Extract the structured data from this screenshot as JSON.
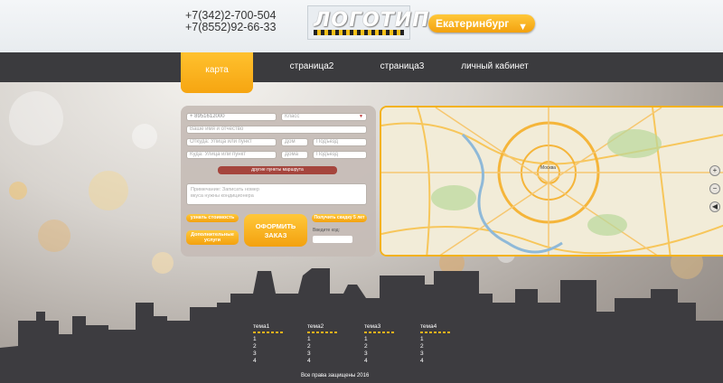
{
  "header": {
    "phone1": "+7(342)2-700-504",
    "phone2": "+7(8552)92-66-33",
    "logo_text": "ЛОГОТИП",
    "city": "Екатеринбург",
    "city_arrow": "▼"
  },
  "nav": {
    "items": [
      {
        "label": "карта",
        "active": true
      },
      {
        "label": "страница2"
      },
      {
        "label": "страница3"
      },
      {
        "label": "личный кабинет"
      }
    ]
  },
  "form": {
    "phone_value": "+ 8951612000",
    "class_select": "Класс",
    "name_placeholder": "Ваше имя и отчество",
    "from_placeholder": "Откуда: Улица или пункт",
    "from_house": "Дом",
    "from_entrance": "Подъезд",
    "to_placeholder": "Куда: Улица или пункт",
    "to_house": "Дома",
    "to_entrance": "Подъезд",
    "route_button": "другие пункты маршрута",
    "comment_placeholder": "Примечание: Записать номер\nвкуса нужны кондиционера",
    "cost_button": "узнать стоимость",
    "extra_button": "Дополнительные услуги",
    "order_button": "ОФОРМИТЬ ЗАКАЗ",
    "promo_button": "Получить скидку 5 лет",
    "code_label": "Введите код:"
  },
  "map": {
    "city_label": "Москва",
    "controls": [
      "+",
      "−",
      "◀"
    ]
  },
  "footer": {
    "columns": [
      {
        "title": "тема1",
        "links": [
          "1",
          "2",
          "3",
          "4"
        ]
      },
      {
        "title": "тема2",
        "links": [
          "1",
          "2",
          "3",
          "4"
        ]
      },
      {
        "title": "тема3",
        "links": [
          "1",
          "2",
          "3",
          "4"
        ]
      },
      {
        "title": "тема4",
        "links": [
          "1",
          "2",
          "3",
          "4"
        ]
      }
    ],
    "copyright": "Все права защищены 2016"
  },
  "colors": {
    "accent": "#f6a511",
    "nav_bg": "#3b3b3e",
    "skyline": "#3d3c40"
  }
}
